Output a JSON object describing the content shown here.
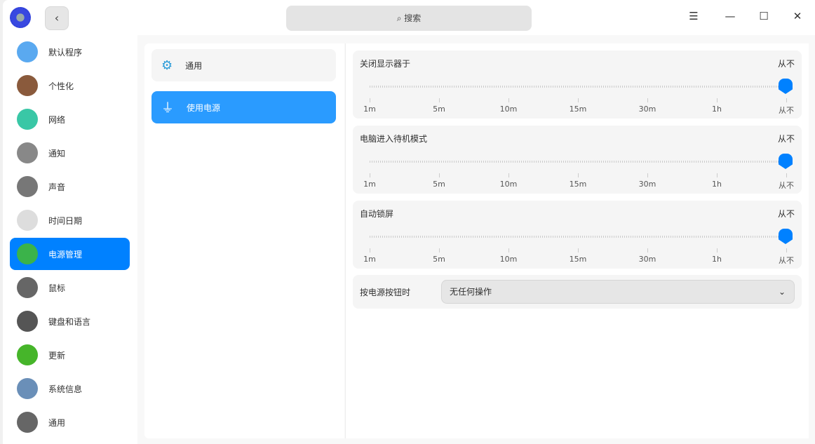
{
  "header": {
    "search_placeholder": "搜索",
    "back": "‹",
    "menu": "☰",
    "minimize": "—",
    "maximize": "☐",
    "close": "✕"
  },
  "sidebar": {
    "items": [
      {
        "label": "默认程序",
        "color": "#5aa9f0"
      },
      {
        "label": "个性化",
        "color": "#8a5a3c"
      },
      {
        "label": "网络",
        "color": "#39c7a6"
      },
      {
        "label": "通知",
        "color": "#888"
      },
      {
        "label": "声音",
        "color": "#777"
      },
      {
        "label": "时间日期",
        "color": "#ddd"
      },
      {
        "label": "电源管理",
        "color": "#3bb34a"
      },
      {
        "label": "鼠标",
        "color": "#666"
      },
      {
        "label": "键盘和语言",
        "color": "#555"
      },
      {
        "label": "更新",
        "color": "#46b52a"
      },
      {
        "label": "系统信息",
        "color": "#6a8fb8"
      },
      {
        "label": "通用",
        "color": "#666"
      }
    ],
    "active_index": 6
  },
  "submenu": {
    "items": [
      {
        "label": "通用"
      },
      {
        "label": "使用电源"
      }
    ],
    "active_index": 1
  },
  "sliders": [
    {
      "label": "关闭显示器于",
      "value": "从不"
    },
    {
      "label": "电脑进入待机模式",
      "value": "从不"
    },
    {
      "label": "自动锁屏",
      "value": "从不"
    }
  ],
  "ticks": [
    "1m",
    "5m",
    "10m",
    "15m",
    "30m",
    "1h",
    "从不"
  ],
  "power_button": {
    "label": "按电源按钮时",
    "value": "无任何操作"
  }
}
